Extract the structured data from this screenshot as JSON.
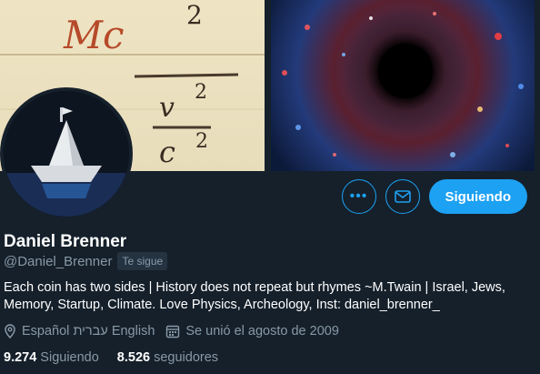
{
  "header": {
    "left_image": "handwritten-formula-photo",
    "left_text_1": "Mc",
    "left_text_2": "2",
    "left_text_3": "v",
    "left_text_4": "2",
    "left_text_5": "c",
    "left_text_6": "2",
    "right_image": "black-hole-galaxy-image"
  },
  "profile": {
    "avatar": "paper-boat-avatar",
    "name": "Daniel Brenner",
    "handle": "@Daniel_Brenner",
    "follows_you_badge": "Te sigue",
    "bio": "Each coin has two sides | History does not repeat but rhymes ~M.Twain | Israel, Jews, Memory, Startup, Climate. Love Physics, Archeology, Inst: daniel_brenner_",
    "location": "Español עברית English",
    "joined": "Se unió el agosto de 2009",
    "following_count": "9.274",
    "following_label": "Siguiendo",
    "followers_count": "8.526",
    "followers_label": "seguidores"
  },
  "actions": {
    "more_icon": "more-icon",
    "message_icon": "mail-icon",
    "follow_button_label": "Siguiendo"
  },
  "colors": {
    "background": "#15202b",
    "accent": "#1da1f2",
    "secondary_text": "#8899a6"
  }
}
